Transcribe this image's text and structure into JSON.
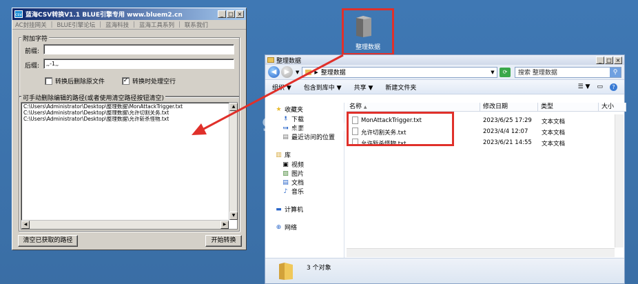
{
  "converter": {
    "title": "蓝海CSV转换V1.1  BLUE引擎专用 www.bluem2.cn",
    "icon_text": "csv",
    "menu": [
      "AC封挂网关",
      "BLUE引擎论坛",
      "蓝海科技",
      "蓝海工具系列",
      "联系我们"
    ],
    "group_add": "附加字符",
    "prefix_label": "前缀:",
    "prefix_value": "",
    "suffix_label": "后缀:",
    "suffix_value": ",,-1,,",
    "chk_delete_label": "转换后删除原文件",
    "chk_delete_checked": false,
    "chk_blank_label": "转换时处理空行",
    "chk_blank_checked": true,
    "group_paths": "可手动删除编辑的路径(或者使用清空路径按钮清空)",
    "paths": [
      "C:\\Users\\Administrator\\Desktop\\整理数据\\MonAttackTrigger.txt",
      "C:\\Users\\Administrator\\Desktop\\整理数据\\允许切割关务.txt",
      "C:\\Users\\Administrator\\Desktop\\整理数据\\允许斩杀怪物.txt"
    ],
    "btn_clear": "清空已获取的路径",
    "btn_start": "开始转换"
  },
  "desktop_folder": {
    "label": "整理数据"
  },
  "explorer": {
    "title": "整理数据",
    "address": "整理数据",
    "search_placeholder": "搜索 整理数据",
    "toolbar": [
      "组织 ▼",
      "包含到库中 ▼",
      "共享 ▼",
      "新建文件夹"
    ],
    "nav": {
      "favorites": "收藏夹",
      "downloads": "下载",
      "desktop": "桌面",
      "recent": "最近访问的位置",
      "libraries": "库",
      "videos": "视频",
      "pictures": "图片",
      "documents": "文档",
      "music": "音乐",
      "computer": "计算机",
      "network": "网络"
    },
    "columns": [
      "名称",
      "修改日期",
      "类型",
      "大小"
    ],
    "files": [
      {
        "name": "MonAttackTrigger.txt",
        "date": "2023/6/25 17:29",
        "type": "文本文档"
      },
      {
        "name": "允许切割关务.txt",
        "date": "2023/4/4 12:07",
        "type": "文本文档"
      },
      {
        "name": "允许斩杀怪物.txt",
        "date": "2023/6/21 14:55",
        "type": "文本文档"
      }
    ],
    "status_count": "3 个对象"
  },
  "watermark": "9Gu.com",
  "colors": {
    "highlight": "#e0302a",
    "desktop": "#3a6ea5",
    "titlebar": "#0a246a"
  }
}
